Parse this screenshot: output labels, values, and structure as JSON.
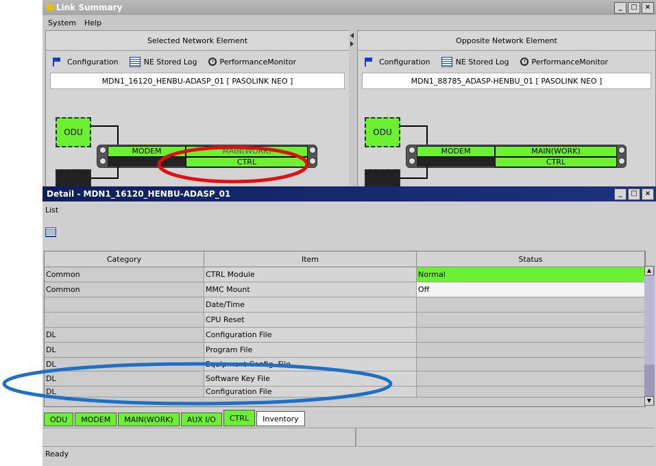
{
  "link_summary": {
    "title": "Link Summary",
    "window_buttons": [
      "_",
      "□",
      "×"
    ],
    "menu": [
      "System",
      "Help"
    ],
    "selected_panel": {
      "header": "Selected Network Element",
      "toolbar": {
        "configuration": "Configuration",
        "ne_stored_log": "NE Stored Log",
        "performance_monitor": "PerformanceMonitor"
      },
      "ne_name": "MDN1_16120_HENBU-ADASP_01 [ PASOLINK NEO ]",
      "blocks": {
        "odu": "ODU",
        "modem": "MODEM",
        "main_work": "MAIN(WORK)",
        "ctrl": "CTRL"
      }
    },
    "opposite_panel": {
      "header": "Opposite Network Element",
      "toolbar": {
        "configuration": "Configuration",
        "ne_stored_log": "NE Stored Log",
        "performance_monitor": "PerformanceMonitor"
      },
      "ne_name": "MDN1_88785_ADASP-HENBU_01 [ PASOLINK NEO ]",
      "blocks": {
        "odu": "ODU",
        "modem": "MODEM",
        "main_work": "MAIN(WORK)",
        "ctrl": "CTRL"
      }
    }
  },
  "detail": {
    "title": "Detail - MDN1_16120_HENBU-ADASP_01",
    "menu": [
      "List"
    ],
    "columns": {
      "category": "Category",
      "item": "Item",
      "status": "Status"
    },
    "rows": [
      {
        "category": "Common",
        "item": "CTRL Module",
        "status": "Normal"
      },
      {
        "category": "Common",
        "item": "MMC Mount",
        "status": "Off"
      },
      {
        "category": "",
        "item": "Date/Time",
        "status": ""
      },
      {
        "category": "",
        "item": "CPU Reset",
        "status": ""
      },
      {
        "category": "DL",
        "item": "Configuration File",
        "status": ""
      },
      {
        "category": "DL",
        "item": "Program File",
        "status": ""
      },
      {
        "category": "DL",
        "item": "Equipment Config. File",
        "status": ""
      },
      {
        "category": "DL",
        "item": "Software Key File",
        "status": ""
      },
      {
        "category": "DL",
        "item": "Configuration File",
        "status": ""
      }
    ],
    "tabs": [
      "ODU",
      "MODEM",
      "MAIN(WORK)",
      "AUX I/O",
      "CTRL",
      "Inventory"
    ],
    "status_bar": "Ready"
  },
  "colors": {
    "module_green": "#6cf032",
    "highlight_red": "#e01010",
    "highlight_blue": "#1f6fc4",
    "detail_title": "#142a6e"
  }
}
